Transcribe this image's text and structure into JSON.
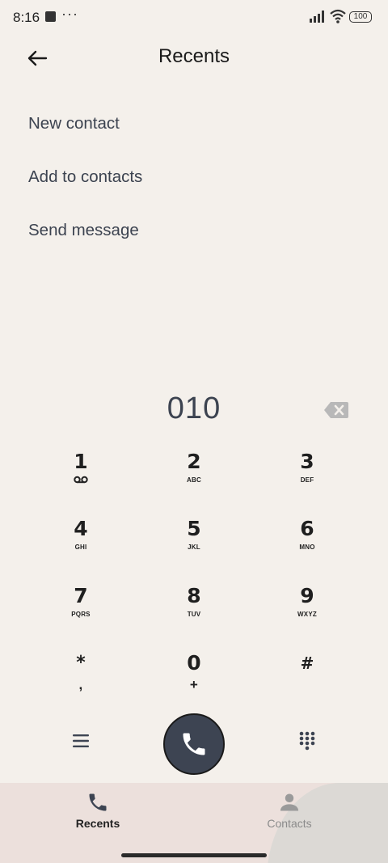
{
  "status": {
    "time": "8:16",
    "more": "···",
    "battery": "100"
  },
  "header": {
    "title": "Recents"
  },
  "options": [
    "New contact",
    "Add to contacts",
    "Send message"
  ],
  "dial": {
    "number": "010"
  },
  "keypad": [
    {
      "digit": "1",
      "sub": ""
    },
    {
      "digit": "2",
      "sub": "ABC"
    },
    {
      "digit": "3",
      "sub": "DEF"
    },
    {
      "digit": "4",
      "sub": "GHI"
    },
    {
      "digit": "5",
      "sub": "JKL"
    },
    {
      "digit": "6",
      "sub": "MNO"
    },
    {
      "digit": "7",
      "sub": "PQRS"
    },
    {
      "digit": "8",
      "sub": "TUV"
    },
    {
      "digit": "9",
      "sub": "WXYZ"
    },
    {
      "digit": "*",
      "sub": ","
    },
    {
      "digit": "0",
      "sub": "+"
    },
    {
      "digit": "#",
      "sub": ""
    }
  ],
  "nav": {
    "recents": "Recents",
    "contacts": "Contacts"
  },
  "colors": {
    "background": "#f4f0eb",
    "call_button": "#3d4452",
    "text_secondary": "#3c4350"
  }
}
